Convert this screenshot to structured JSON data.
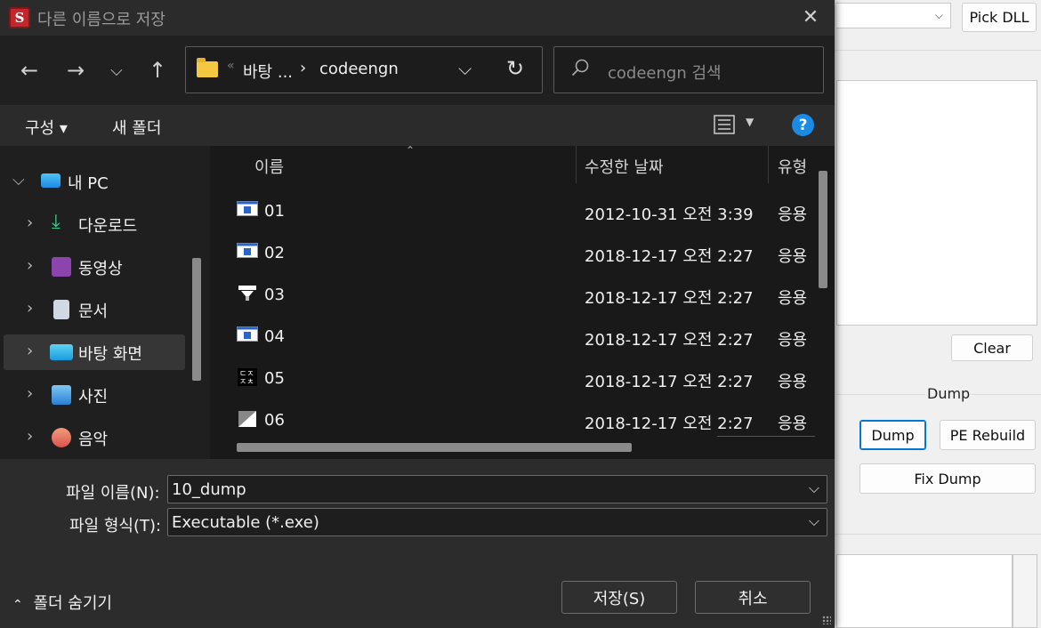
{
  "background_app": {
    "pick_dll_label": "Pick DLL",
    "clear_label": "Clear",
    "dump_group_label": "Dump",
    "dump_label": "Dump",
    "pe_rebuild_label": "PE Rebuild",
    "fix_dump_label": "Fix Dump"
  },
  "dialog": {
    "title": "다른 이름으로 저장",
    "app_icon_letter": "S",
    "address": {
      "overflow": "«",
      "segments": [
        "바탕 ...",
        "codeengn"
      ],
      "separator": "›"
    },
    "search_placeholder": "codeengn 검색",
    "commands": {
      "organize": "구성 ▾",
      "new_folder": "새 폴더"
    },
    "nav": [
      {
        "label": "내 PC",
        "icon": "pc-icon",
        "expanded": true
      },
      {
        "label": "다운로드",
        "icon": "download-icon"
      },
      {
        "label": "동영상",
        "icon": "video-icon"
      },
      {
        "label": "문서",
        "icon": "document-icon"
      },
      {
        "label": "바탕 화면",
        "icon": "desktop-icon",
        "selected": true
      },
      {
        "label": "사진",
        "icon": "pictures-icon"
      },
      {
        "label": "음악",
        "icon": "music-icon"
      }
    ],
    "columns": {
      "name": "이름",
      "date": "수정한 날짜",
      "type": "유형"
    },
    "files": [
      {
        "name": "01",
        "date": "2012-10-31 오전 3:39",
        "type": "응용",
        "icon": "app-window-icon"
      },
      {
        "name": "02",
        "date": "2018-12-17 오전 2:27",
        "type": "응용",
        "icon": "app-window-icon"
      },
      {
        "name": "03",
        "date": "2018-12-17 오전 2:27",
        "type": "응용",
        "icon": "funnel-app-icon"
      },
      {
        "name": "04",
        "date": "2018-12-17 오전 2:27",
        "type": "응용",
        "icon": "app-window-icon"
      },
      {
        "name": "05",
        "date": "2018-12-17 오전 2:27",
        "type": "응용",
        "icon": "glyph-app-icon"
      },
      {
        "name": "06",
        "date": "2018-12-17 오전 2:27",
        "type": "응용",
        "icon": "triangle-app-icon"
      }
    ],
    "filename_label": "파일 이름(N):",
    "filename_value": "10_dump",
    "filetype_label": "파일 형식(T):",
    "filetype_value": "Executable (*.exe)",
    "hide_folders": "폴더 숨기기",
    "save_label": "저장(S)",
    "cancel_label": "취소"
  }
}
